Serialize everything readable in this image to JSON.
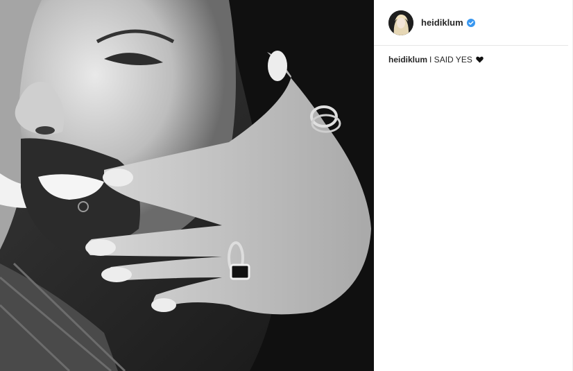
{
  "post": {
    "photo_alt": "",
    "author": {
      "username": "heidiklum",
      "verified_icon": "verified-badge-icon",
      "verified_color": "#3897f0"
    },
    "caption": {
      "username": "heidiklum",
      "text": "I SAID YES",
      "emoji_icon": "black-heart-icon"
    }
  }
}
